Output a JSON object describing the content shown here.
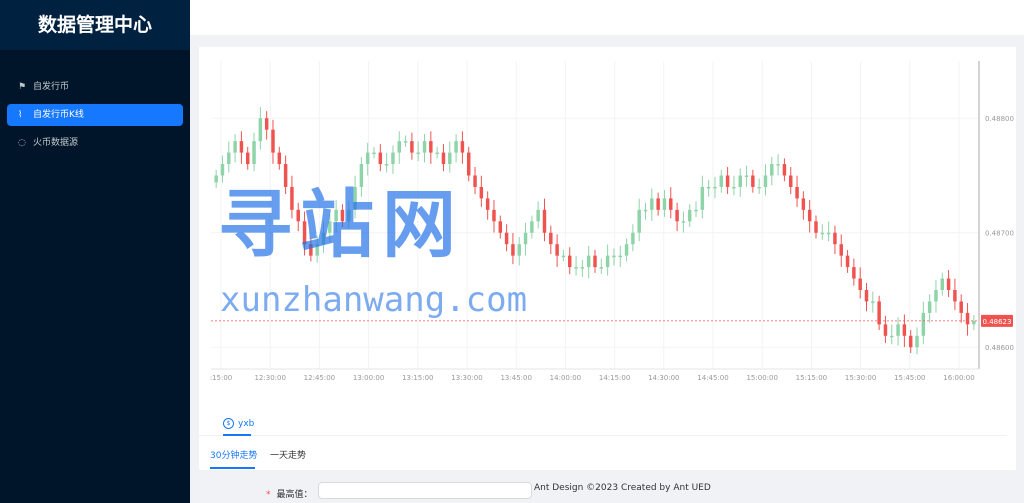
{
  "app": {
    "title": "数据管理中心"
  },
  "sidebar": {
    "items": [
      {
        "label": "自发行币",
        "icon": "flag-icon"
      },
      {
        "label": "自发行币K线",
        "icon": "line-chart-icon",
        "active": true
      },
      {
        "label": "火币数据源",
        "icon": "fire-icon"
      }
    ]
  },
  "chart_data": {
    "type": "candlestick",
    "title": "",
    "x_ticks": [
      ":15:00",
      "12:30:00",
      "12:45:00",
      "13:00:00",
      "13:15:00",
      "13:30:00",
      "13:45:00",
      "14:00:00",
      "14:15:00",
      "14:30:00",
      "14:45:00",
      "15:00:00",
      "15:15:00",
      "15:30:00",
      "15:45:00",
      "16:00:00"
    ],
    "y_ticks": [
      0.486,
      0.487,
      0.488
    ],
    "y_tick_labels": [
      "0.48600",
      "0.48700",
      "0.48800"
    ],
    "ylim": [
      0.48581,
      0.4885
    ],
    "last_price": 0.48623,
    "last_price_label": "0.48623",
    "colors": {
      "up": "#8fd4a8",
      "down": "#ef5350",
      "axis": "#aaaaaa",
      "grid": "#f3f3f3"
    },
    "closes": [
      0.4875,
      0.4876,
      0.4877,
      0.4878,
      0.4877,
      0.4876,
      0.4878,
      0.488,
      0.4879,
      0.4877,
      0.4876,
      0.4874,
      0.4872,
      0.4871,
      0.4869,
      0.4868,
      0.4869,
      0.487,
      0.4871,
      0.4872,
      0.4871,
      0.4872,
      0.4874,
      0.4876,
      0.4877,
      0.4877,
      0.4876,
      0.4876,
      0.4877,
      0.4878,
      0.4878,
      0.4877,
      0.4877,
      0.4878,
      0.4877,
      0.4877,
      0.4876,
      0.4877,
      0.4878,
      0.4877,
      0.4875,
      0.4874,
      0.4873,
      0.4872,
      0.4871,
      0.487,
      0.4869,
      0.4868,
      0.4869,
      0.487,
      0.4871,
      0.4872,
      0.487,
      0.4869,
      0.4868,
      0.4868,
      0.4867,
      0.4867,
      0.4867,
      0.4868,
      0.4867,
      0.4867,
      0.4868,
      0.4868,
      0.4868,
      0.4869,
      0.487,
      0.4872,
      0.4872,
      0.4873,
      0.4872,
      0.4873,
      0.4872,
      0.4871,
      0.4871,
      0.4872,
      0.4872,
      0.4874,
      0.4874,
      0.4874,
      0.4875,
      0.4874,
      0.4874,
      0.4875,
      0.4875,
      0.4874,
      0.4874,
      0.4875,
      0.4876,
      0.4876,
      0.4875,
      0.4874,
      0.4873,
      0.4872,
      0.4871,
      0.487,
      0.487,
      0.487,
      0.4869,
      0.4868,
      0.4867,
      0.4866,
      0.4865,
      0.4864,
      0.4864,
      0.4862,
      0.4861,
      0.4861,
      0.4862,
      0.4861,
      0.486,
      0.4861,
      0.4863,
      0.4864,
      0.4865,
      0.4866,
      0.4865,
      0.4864,
      0.4863,
      0.4862,
      0.48623
    ]
  },
  "tabs": {
    "primary": [
      {
        "label": "yxb"
      }
    ],
    "secondary": [
      {
        "label": "30分钟走势"
      },
      {
        "label": "一天走势"
      }
    ]
  },
  "form": {
    "max_label": "最高值：",
    "required_mark": "*",
    "max_value": ""
  },
  "footer": {
    "text": "Ant Design ©2023 Created by Ant UED"
  },
  "watermark": {
    "cn": "寻站网",
    "en": "xunzhanwang.com"
  }
}
